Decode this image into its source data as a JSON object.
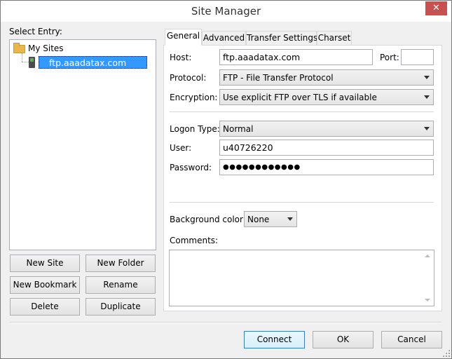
{
  "window": {
    "title": "Site Manager",
    "close_glyph": "✕"
  },
  "left": {
    "select_entry_label": "Select Entry:",
    "tree": {
      "root": "My Sites",
      "child": "ftp.aaadatax.com"
    },
    "buttons": {
      "new_site": "New Site",
      "new_folder": "New Folder",
      "new_bookmark": "New Bookmark",
      "rename": "Rename",
      "delete": "Delete",
      "duplicate": "Duplicate"
    }
  },
  "tabs": [
    "General",
    "Advanced",
    "Transfer Settings",
    "Charset"
  ],
  "general": {
    "host_label": "Host:",
    "host_value": "ftp.aaadatax.com",
    "port_label": "Port:",
    "port_value": "",
    "protocol_label": "Protocol:",
    "protocol_value": "FTP - File Transfer Protocol",
    "encryption_label": "Encryption:",
    "encryption_value": "Use explicit FTP over TLS if available",
    "logon_type_label": "Logon Type:",
    "logon_type_value": "Normal",
    "user_label": "User:",
    "user_value": "u40726220",
    "password_label": "Password:",
    "password_value": "●●●●●●●●●●●●",
    "bg_color_label": "Background color:",
    "bg_color_value": "None",
    "comments_label": "Comments:"
  },
  "footer": {
    "connect": "Connect",
    "ok": "OK",
    "cancel": "Cancel"
  },
  "colors": {
    "selection": "#3399ff",
    "close": "#c75050"
  },
  "icons": {
    "tree_root": "folder-icon",
    "tree_child": "server-icon"
  }
}
